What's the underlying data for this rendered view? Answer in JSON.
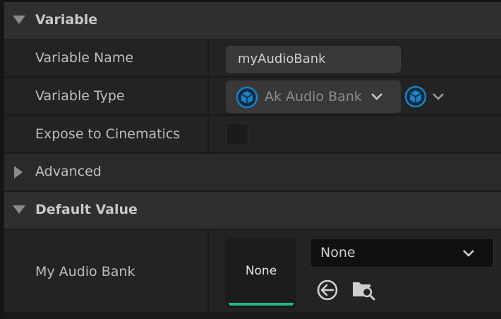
{
  "sections": {
    "variable": {
      "title": "Variable"
    },
    "advanced": {
      "title": "Advanced"
    },
    "default_value": {
      "title": "Default Value"
    }
  },
  "properties": {
    "variable_name": {
      "label": "Variable Name",
      "value": "myAudioBank"
    },
    "variable_type": {
      "label": "Variable Type",
      "value": "Ak Audio Bank"
    },
    "expose_to_cinematics": {
      "label": "Expose to Cinematics",
      "checked": false
    },
    "my_audio_bank": {
      "label": "My Audio Bank",
      "thumbnail_text": "None",
      "selected": "None"
    }
  },
  "colors": {
    "asset_accent": "#1fb886",
    "pin_icon": "#1e7fc4"
  },
  "icons": {
    "section_expanded": "triangle-down-icon",
    "section_collapsed": "triangle-right-icon",
    "type_pin": "cube-icon",
    "use_selected": "arrow-left-circle-icon",
    "browse": "folder-search-icon"
  }
}
